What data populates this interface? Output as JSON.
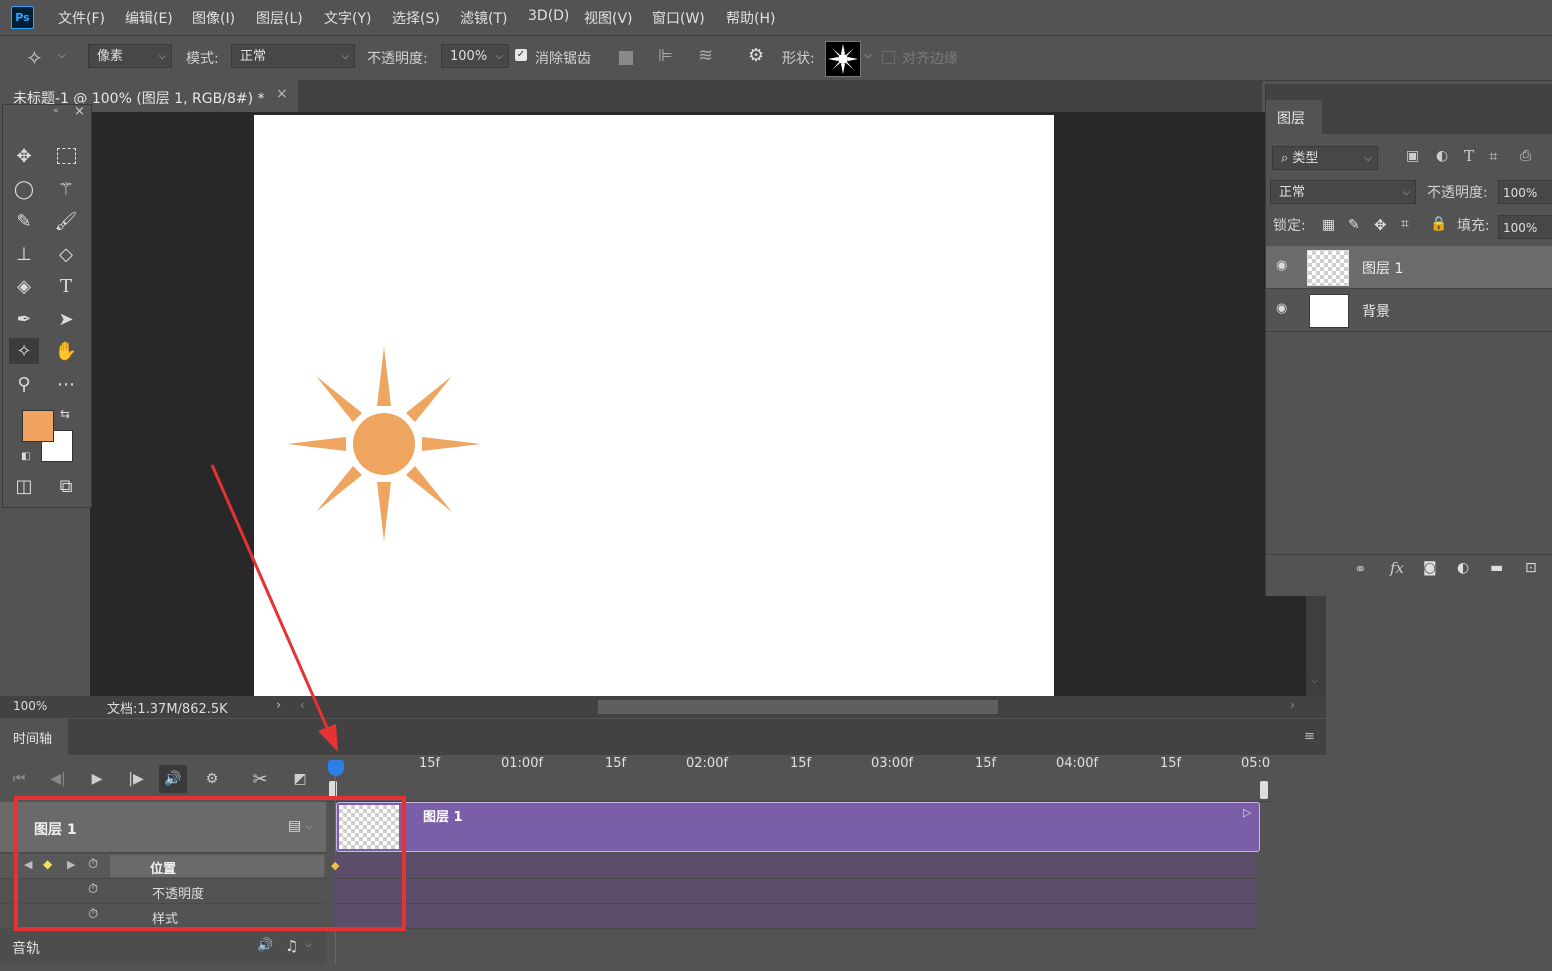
{
  "app": {
    "logo": "Ps"
  },
  "menu": [
    "文件(F)",
    "编辑(E)",
    "图像(I)",
    "图层(L)",
    "文字(Y)",
    "选择(S)",
    "滤镜(T)",
    "3D(D)",
    "视图(V)",
    "窗口(W)",
    "帮助(H)"
  ],
  "options": {
    "fill_mode": "像素",
    "mode_label": "模式:",
    "mode_value": "正常",
    "opacity_label": "不透明度:",
    "opacity_value": "100%",
    "antialias_label": "消除锯齿",
    "shape_label": "形状:",
    "align_edges_label": "对齐边缘"
  },
  "document": {
    "tab_title": "未标题-1 @ 100% (图层 1, RGB/8#) *",
    "zoom": "100%",
    "doc_info": "文档:1.37M/862.5K"
  },
  "colors": {
    "foreground": "#f0a35e",
    "background": "#ffffff",
    "sun": "#eea55f",
    "clip": "#7b5ea8",
    "highlight": "#e63232"
  },
  "layers_panel": {
    "tab_label": "图层",
    "filter_label": "类型",
    "blend_mode": "正常",
    "opacity_label": "不透明度:",
    "opacity_value": "100%",
    "lock_label": "锁定:",
    "fill_label": "填充:",
    "fill_value": "100%",
    "layers": [
      {
        "name": "图层 1",
        "selected": true
      },
      {
        "name": "背景",
        "selected": false
      }
    ]
  },
  "timeline": {
    "tab_label": "时间轴",
    "ruler": [
      "15f",
      "01:00f",
      "15f",
      "02:00f",
      "15f",
      "03:00f",
      "15f",
      "04:00f",
      "15f",
      "05:0"
    ],
    "layer_name": "图层 1",
    "clip_name": "图层 1",
    "properties": [
      "位置",
      "不透明度",
      "样式"
    ],
    "audio_label": "音轨"
  }
}
